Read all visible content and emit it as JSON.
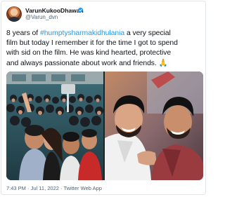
{
  "author": {
    "display_name": "VarunKukooDhawan",
    "handle": "@Varun_dvn",
    "verified_icon": "verified-badge-icon",
    "verified_color": "#1d9bf0"
  },
  "tweet": {
    "line1_prefix": "8 years of ",
    "hashtag": "#humptysharmakidhulania",
    "line1_suffix": " a very special",
    "line2": "film but today I remember it for the time I got to spend",
    "line3": "with sid on the film. He was kind hearted, protective",
    "line4_text": "and always passionate about work and friends. ",
    "emoji": "🙏",
    "hashtag_color": "#1d9bf0"
  },
  "media": {
    "left_photo": "crowd-selfie-photo",
    "right_photo": "two-actors-smiling-photo"
  },
  "meta": {
    "time": "7:43 PM",
    "separator": " · ",
    "date": "Jul 11, 2022",
    "source": "Twitter Web App"
  }
}
